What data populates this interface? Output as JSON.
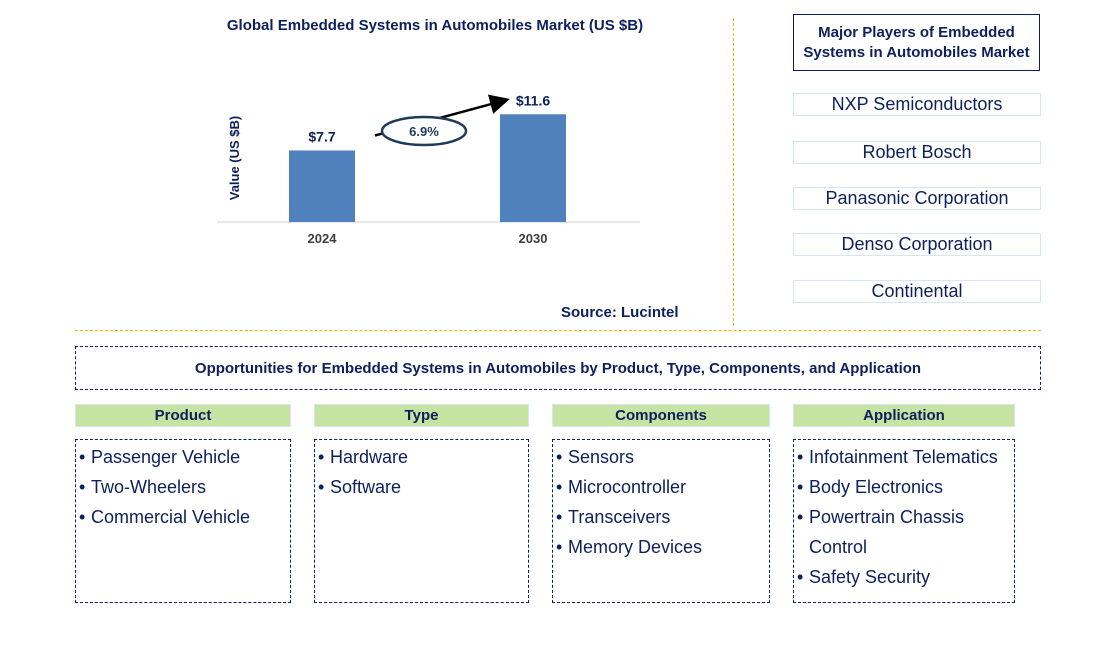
{
  "chart_data": {
    "type": "bar",
    "title": "Global Embedded Systems in Automobiles Market (US $B)",
    "xlabel": "",
    "ylabel": "Value (US $B)",
    "categories": [
      "2024",
      "2030"
    ],
    "values": [
      7.7,
      11.6
    ],
    "value_labels": [
      "$7.7",
      "$11.6"
    ],
    "ylim": [
      0,
      14
    ],
    "grid": false,
    "annotation": {
      "type": "cagr-arrow",
      "label": "6.9%"
    },
    "bar_color": "#4f81bd",
    "source": "Source: Lucintel"
  },
  "players": {
    "title": "Major Players of Embedded Systems in Automobiles Market",
    "items": [
      "NXP Semiconductors",
      "Robert Bosch",
      "Panasonic Corporation",
      "Denso Corporation",
      "Continental"
    ]
  },
  "opportunities": {
    "title": "Opportunities for Embedded Systems in Automobiles by Product, Type, Components, and Application",
    "categories": [
      {
        "label": "Product",
        "items": [
          "Passenger Vehicle",
          "Two-Wheelers",
          "Commercial Vehicle"
        ]
      },
      {
        "label": "Type",
        "items": [
          "Hardware",
          "Software"
        ]
      },
      {
        "label": "Components",
        "items": [
          "Sensors",
          "Microcontroller",
          "Transceivers",
          "Memory Devices"
        ]
      },
      {
        "label": "Application",
        "items": [
          "Infotainment Telematics",
          "Body Electronics",
          "Powertrain Chassis Control",
          "Safety Security"
        ]
      }
    ]
  },
  "colors": {
    "text": "#0d1f5c",
    "accent_line": "#f5b800",
    "header_fill": "#c6e3a1",
    "bar": "#4f81bd"
  }
}
